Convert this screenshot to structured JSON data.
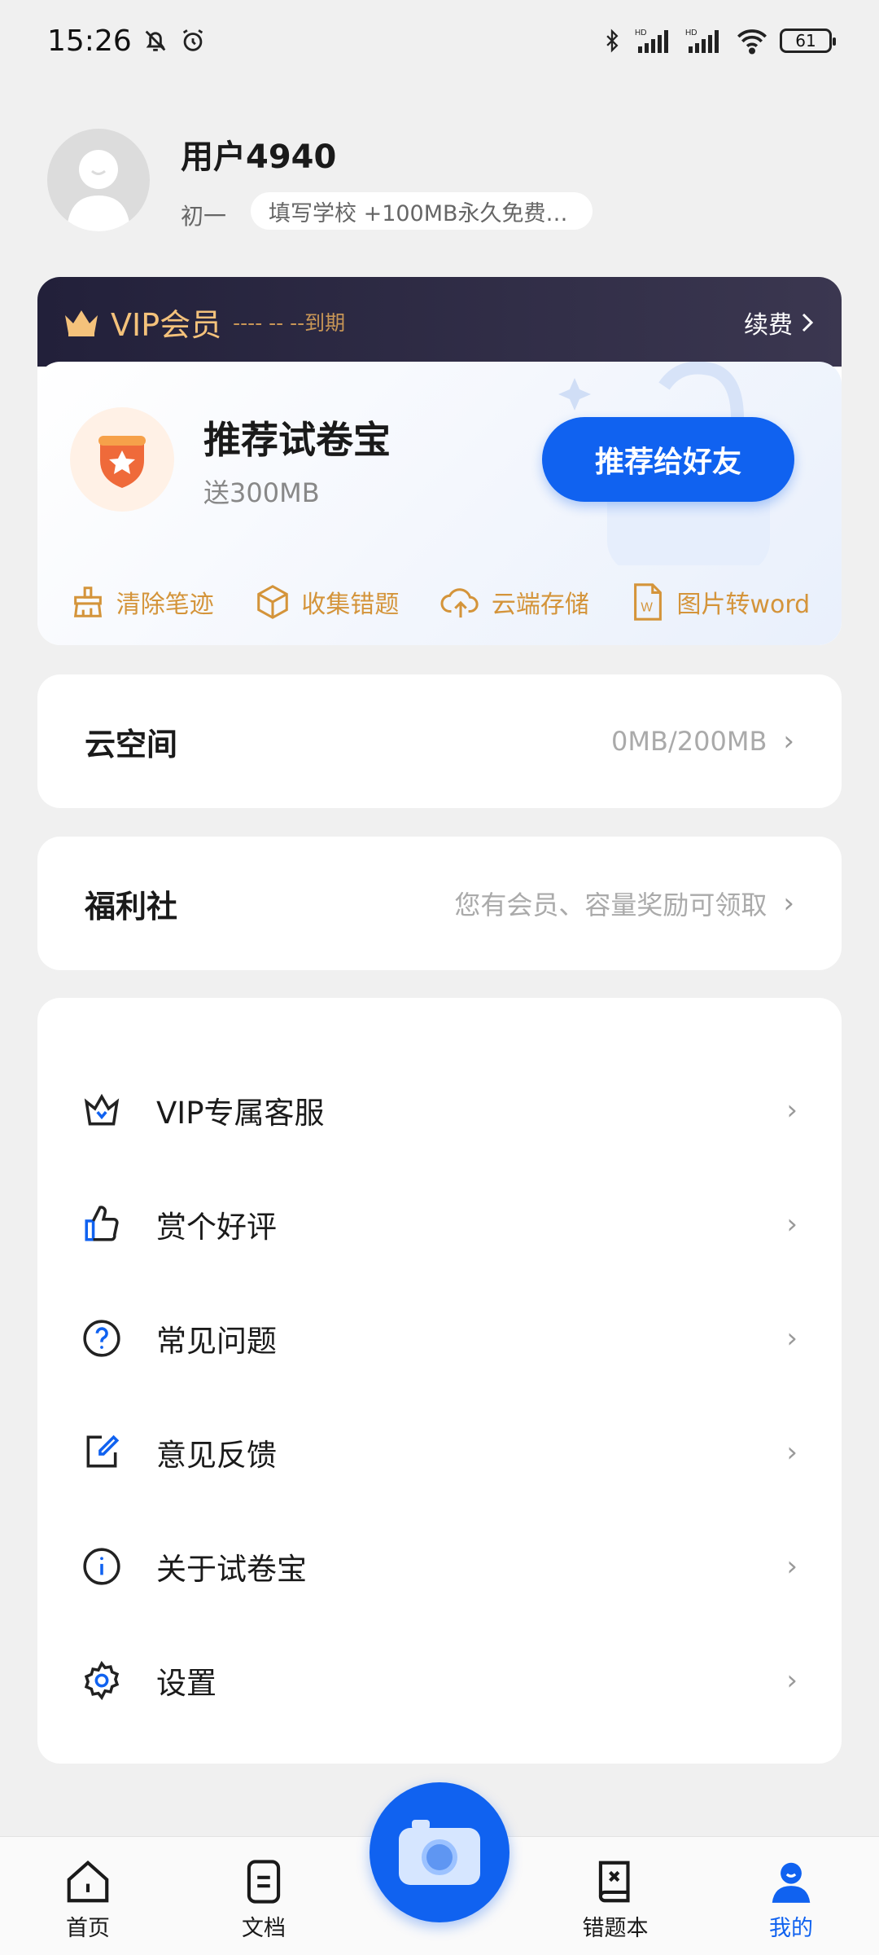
{
  "status_bar": {
    "time": "15:26",
    "battery": "61",
    "icons": [
      "bell-off-icon",
      "alarm-icon",
      "bluetooth-icon",
      "signal-hd-icon",
      "signal-hd-icon",
      "wifi-icon",
      "battery-icon"
    ]
  },
  "profile": {
    "username": "用户4940",
    "grade": "初一",
    "school_prompt": "填写学校 +100MB永久免费…"
  },
  "vip": {
    "title": "VIP会员",
    "expire": "---- -- --到期",
    "renew": "续费",
    "recommend_title": "推荐试卷宝",
    "recommend_sub": "送300MB",
    "recommend_button": "推荐给好友",
    "features": [
      {
        "label": "清除笔迹",
        "icon": "eraser-icon"
      },
      {
        "label": "收集错题",
        "icon": "box-icon"
      },
      {
        "label": "云端存储",
        "icon": "cloud-upload-icon"
      },
      {
        "label": "图片转word",
        "icon": "word-file-icon"
      }
    ],
    "colors": {
      "gold": "#d4943a",
      "header_bg": "#22203a",
      "accent": "#1062f0"
    }
  },
  "cloud": {
    "title": "云空间",
    "value": "0MB/200MB"
  },
  "welfare": {
    "title": "福利社",
    "value": "您有会员、容量奖励可领取"
  },
  "menu": [
    {
      "label": "VIP专属客服",
      "icon": "vip-crown-icon"
    },
    {
      "label": "赏个好评",
      "icon": "thumbs-up-icon"
    },
    {
      "label": "常见问题",
      "icon": "question-icon"
    },
    {
      "label": "意见反馈",
      "icon": "edit-icon"
    },
    {
      "label": "关于试卷宝",
      "icon": "info-icon"
    },
    {
      "label": "设置",
      "icon": "gear-icon"
    }
  ],
  "bottom_nav": {
    "items": [
      {
        "label": "首页",
        "icon": "home-icon"
      },
      {
        "label": "文档",
        "icon": "document-icon"
      },
      {
        "label": "错题本",
        "icon": "error-book-icon"
      },
      {
        "label": "我的",
        "icon": "profile-icon",
        "active": true
      }
    ],
    "camera_icon": "camera-icon"
  }
}
